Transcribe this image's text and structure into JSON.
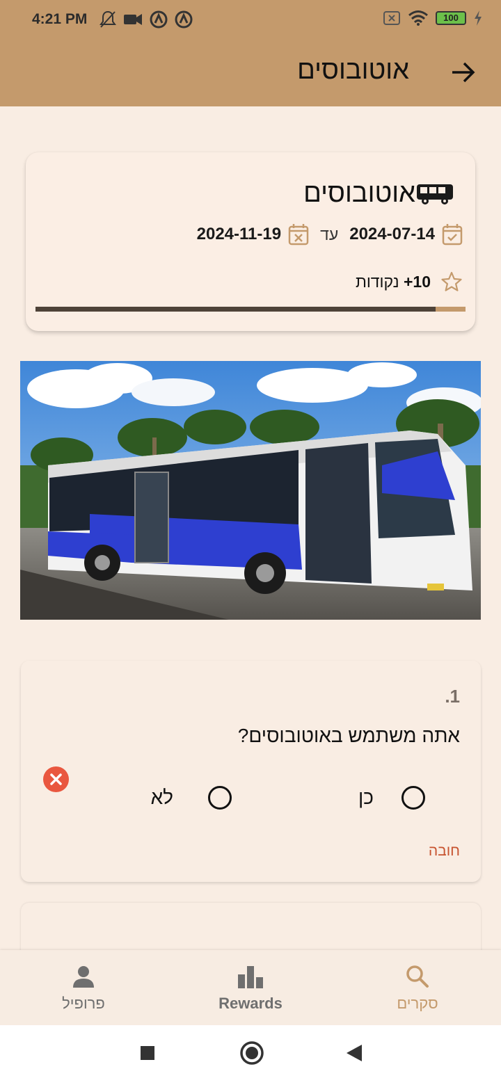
{
  "status_bar": {
    "time": "4:21 PM",
    "battery": "100",
    "icons": [
      "notifications-off-icon",
      "video-camera-icon",
      "circle-a-icon",
      "circle-a-icon",
      "sim-off-icon",
      "wifi-icon",
      "battery-icon",
      "charging-icon"
    ]
  },
  "app_bar": {
    "title": "אוטובוסים",
    "back_icon": "arrow-right-icon"
  },
  "survey_card": {
    "title": "אוטובוסים",
    "title_icon": "bus-icon",
    "start_date": "2024-07-14",
    "separator": "עד",
    "end_date": "2024-11-19",
    "points_value": "+10",
    "points_label": "נקודות",
    "progress": 0.93,
    "colors": {
      "progress_fill": "#4e4238",
      "progress_track": "#c49a6c"
    }
  },
  "question": {
    "number": ".1",
    "text": "אתה משתמש באוטובוסים?",
    "options": [
      "כן",
      "לא"
    ],
    "required_label": "חובה"
  },
  "bottom_nav": {
    "items": [
      {
        "label": "סקרים",
        "icon": "search-icon",
        "active": true
      },
      {
        "label": "Rewards",
        "icon": "bar-chart-icon",
        "active": false
      },
      {
        "label": "פרופיל",
        "icon": "person-icon",
        "active": false
      }
    ]
  },
  "colors": {
    "accent": "#c49a6c",
    "background": "#f9ede3",
    "required": "#c7532f",
    "clear": "#e9573f"
  }
}
